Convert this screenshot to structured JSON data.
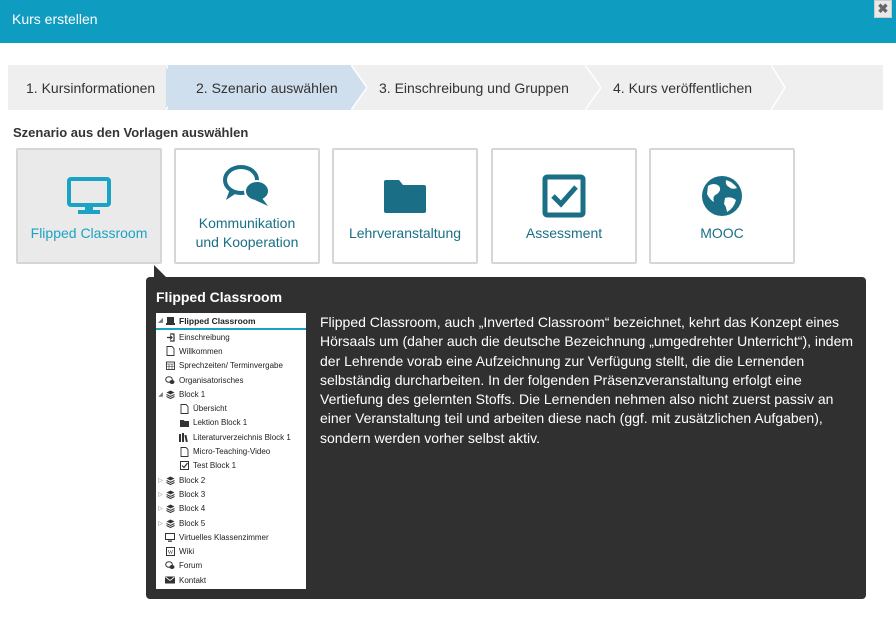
{
  "dialog": {
    "title": "Kurs erstellen",
    "close_symbol": "✖"
  },
  "wizard": {
    "steps": [
      {
        "label": "1. Kursinformationen"
      },
      {
        "label": "2. Szenario auswählen"
      },
      {
        "label": "3. Einschreibung und Gruppen"
      },
      {
        "label": "4. Kurs veröffentlichen"
      }
    ]
  },
  "section": {
    "heading": "Szenario aus den Vorlagen auswählen"
  },
  "scenarios": [
    {
      "label": "Flipped Classroom",
      "icon": "monitor-icon",
      "selected": true
    },
    {
      "label_line1": "Kommunikation",
      "label_line2": "und Kooperation",
      "icon": "chat-bubbles-icon"
    },
    {
      "label": "Lehrveranstaltung",
      "icon": "folder-icon"
    },
    {
      "label": "Assessment",
      "icon": "checkbox-icon"
    },
    {
      "label": "MOOC",
      "icon": "globe-icon"
    }
  ],
  "colors": {
    "accent": "#0e9cc0",
    "icon": "#1a6f86",
    "selected_text": "#1aa3c4",
    "tooltip_bg": "#303030"
  },
  "tooltip": {
    "title": "Flipped Classroom",
    "description": "Flipped Classroom, auch „Inverted Classroom“ bezeichnet, kehrt das Konzept eines Hörsaals um (daher auch die deutsche Bezeichnung „umgedrehter Unterricht“), indem der Lehrende vorab eine Aufzeichnung zur Verfügung stellt, die die Lernenden selbständig durcharbeiten. In der folgenden Präsenzveranstaltung erfolgt eine Vertiefung des gelernten Stoffs. Die Lernenden nehmen also nicht zuerst passiv an einer Veranstaltung teil und arbeiten diese nach (ggf. mit zusätzlichen Aufgaben), sondern werden vorher selbst aktiv.",
    "preview": {
      "root": "Flipped Classroom",
      "items": [
        {
          "label": "Einschreibung",
          "icon": "enter-icon",
          "level": 1
        },
        {
          "label": "Willkommen",
          "icon": "page-icon",
          "level": 1
        },
        {
          "label": "Sprechzeiten/ Terminvergabe",
          "icon": "calendar-icon",
          "level": 1
        },
        {
          "label": "Organisatorisches",
          "icon": "chat-icon",
          "level": 1
        },
        {
          "label": "Block 1",
          "icon": "stack-icon",
          "level": 1,
          "expanded": true
        },
        {
          "label": "Übersicht",
          "icon": "page-icon",
          "level": 2
        },
        {
          "label": "Lektion Block 1",
          "icon": "folder-icon",
          "level": 2
        },
        {
          "label": "Literaturverzeichnis Block 1",
          "icon": "books-icon",
          "level": 2
        },
        {
          "label": "Micro-Teaching-Video",
          "icon": "page-icon",
          "level": 2
        },
        {
          "label": "Test Block 1",
          "icon": "checkbox-icon",
          "level": 2
        },
        {
          "label": "Block 2",
          "icon": "stack-icon",
          "level": 1,
          "collapsed": true
        },
        {
          "label": "Block 3",
          "icon": "stack-icon",
          "level": 1,
          "collapsed": true
        },
        {
          "label": "Block 4",
          "icon": "stack-icon",
          "level": 1,
          "collapsed": true
        },
        {
          "label": "Block 5",
          "icon": "stack-icon",
          "level": 1,
          "collapsed": true
        },
        {
          "label": "Virtuelles Klassenzimmer",
          "icon": "monitor-icon",
          "level": 1
        },
        {
          "label": "Wiki",
          "icon": "wiki-icon",
          "level": 1
        },
        {
          "label": "Forum",
          "icon": "chat-icon",
          "level": 1
        },
        {
          "label": "Kontakt",
          "icon": "mail-icon",
          "level": 1
        }
      ]
    }
  }
}
